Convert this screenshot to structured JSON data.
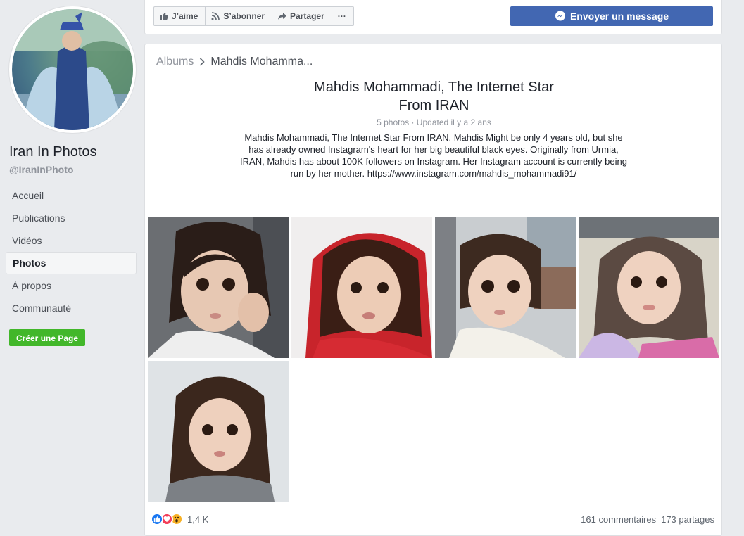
{
  "sidebar": {
    "page_name": "Iran In Photos",
    "page_handle": "@IranInPhoto",
    "nav": [
      "Accueil",
      "Publications",
      "Vidéos",
      "Photos",
      "À propos",
      "Communauté"
    ],
    "active_nav": "Photos",
    "create_page": "Créer une Page"
  },
  "topbar": {
    "like": "J’aime",
    "subscribe": "S’abonner",
    "share": "Partager",
    "more": "···",
    "message": "Envoyer un message"
  },
  "album": {
    "breadcrumb_root": "Albums",
    "breadcrumb_current": "Mahdis Mohamma...",
    "title_line1": "Mahdis Mohammadi, The Internet Star",
    "title_line2": "From IRAN",
    "meta": "5 photos · Updated il y a 2 ans",
    "description": "Mahdis Mohammadi, The Internet Star From IRAN. Mahdis Might be only 4 years old, but she has already owned Instagram's heart for her big beautiful black eyes. Originally from Urmia, IRAN, Mahdis has about 100K followers on Instagram. Her Instagram account is currently being run by her mother. https://www.instagram.com/mahdis_mohammadi91/",
    "photo_count": 5
  },
  "footer": {
    "reaction_count": "1,4 K",
    "comments": "161 commentaires",
    "shares": "173 partages",
    "reactions": [
      "like-icon",
      "love-icon",
      "wow-icon"
    ]
  },
  "colors": {
    "brand_blue": "#4267b2",
    "green": "#42b72a",
    "background": "#e9ebee"
  }
}
